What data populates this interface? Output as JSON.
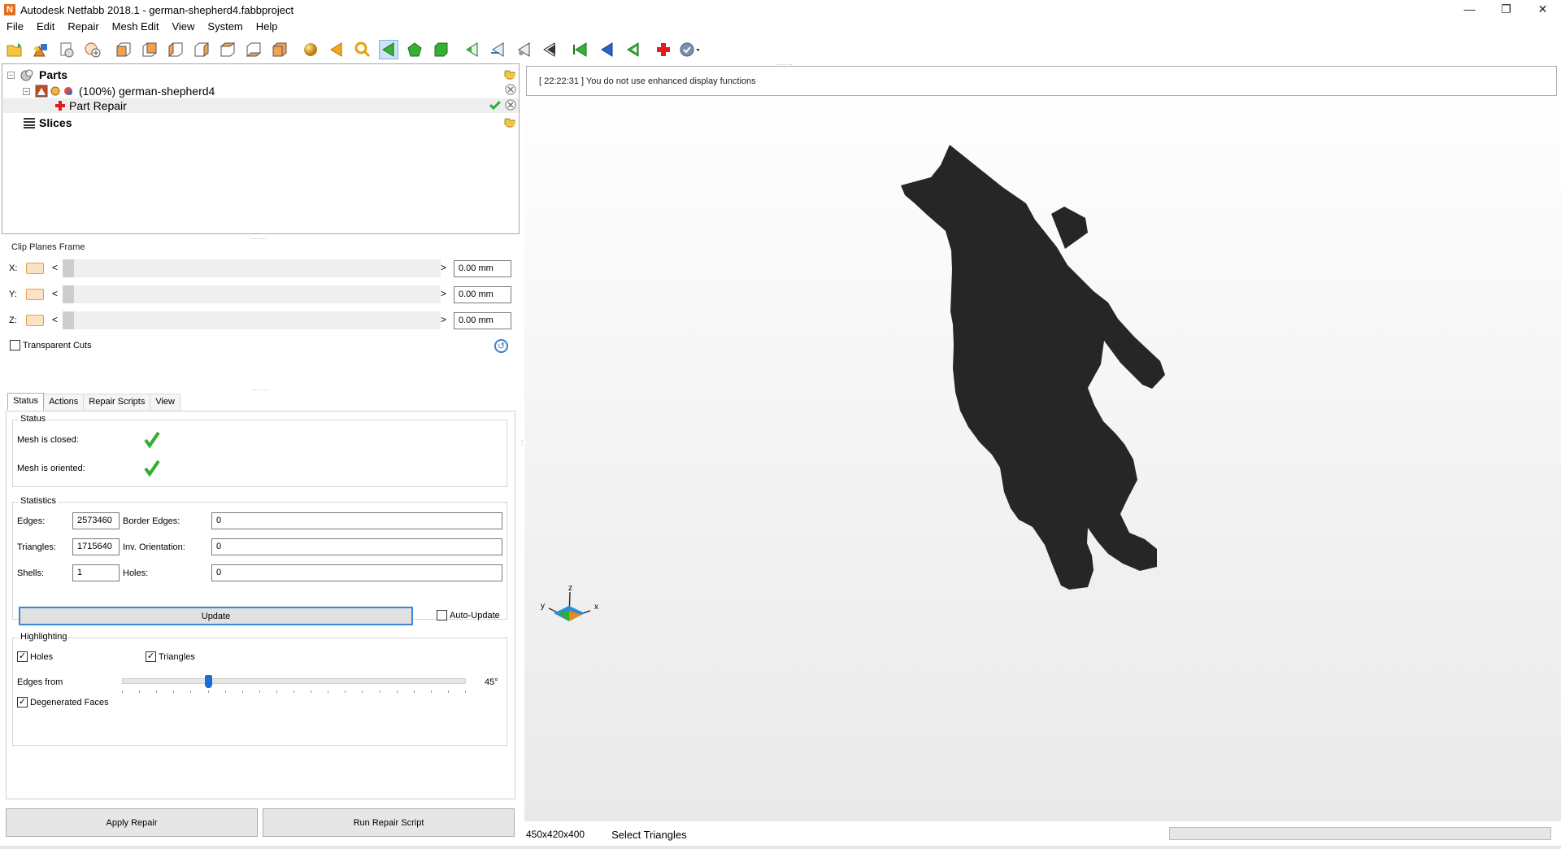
{
  "window": {
    "title": "Autodesk Netfabb 2018.1 - german-shepherd4.fabbproject",
    "app_icon_letter": "N",
    "controls": {
      "minimize": "—",
      "restore": "❐",
      "close": "✕"
    }
  },
  "menu": [
    "File",
    "Edit",
    "Repair",
    "Mesh Edit",
    "View",
    "System",
    "Help"
  ],
  "toolbar": {
    "icons": [
      "open-project-icon",
      "add-part-icon",
      "project-settings-icon",
      "new-part-icon",
      "view-front-icon",
      "view-back-icon",
      "view-left-icon",
      "view-right-icon",
      "view-top-icon",
      "view-bottom-icon",
      "view-iso-icon",
      "sphere-icon",
      "arrow-left-icon",
      "zoom-icon",
      "select-triangle-icon",
      "select-surface-icon",
      "select-shell-icon",
      "add-triangle-icon",
      "split-icon",
      "remove-icon",
      "cut-icon",
      "select-all-icon",
      "invert-selection-icon",
      "deselect-icon",
      "repair-icon",
      "help-icon"
    ]
  },
  "tree": {
    "parts_label": "Parts",
    "part_name": "(100%) german-shepherd4",
    "repair_label": "Part Repair",
    "slices_label": "Slices"
  },
  "clip": {
    "title": "Clip Planes Frame",
    "rows": [
      {
        "axis": "X:",
        "value": "0.00 mm"
      },
      {
        "axis": "Y:",
        "value": "0.00 mm"
      },
      {
        "axis": "Z:",
        "value": "0.00 mm"
      }
    ],
    "left_arrow": "<",
    "right_arrow": ">",
    "transparent_label": "Transparent Cuts"
  },
  "tabs": [
    "Status",
    "Actions",
    "Repair Scripts",
    "View"
  ],
  "status": {
    "group_title": "Status",
    "mesh_closed": "Mesh is closed:",
    "mesh_oriented": "Mesh is oriented:"
  },
  "statistics": {
    "group_title": "Statistics",
    "edges_label": "Edges:",
    "edges": "2573460",
    "border_edges_label": "Border Edges:",
    "border_edges": "0",
    "triangles_label": "Triangles:",
    "triangles": "1715640",
    "inv_orientation_label": "Inv. Orientation:",
    "inv_orientation": "0",
    "shells_label": "Shells:",
    "shells": "1",
    "holes_label": "Holes:",
    "holes": "0",
    "update_label": "Update",
    "auto_update_label": "Auto-Update"
  },
  "highlighting": {
    "group_title": "Highlighting",
    "holes_label": "Holes",
    "triangles_label": "Triangles",
    "edges_from_label": "Edges from",
    "edges_from_value": "45°",
    "edges_from_fraction": 0.25,
    "degenerated_label": "Degenerated Faces"
  },
  "buttons": {
    "apply_repair": "Apply Repair",
    "run_script": "Run Repair Script"
  },
  "viewport": {
    "log": "[ 22:22:31 ] You do not use enhanced display functions",
    "axis_x": "x",
    "axis_y": "y",
    "axis_z": "z"
  },
  "statusbar": {
    "dimensions": "450x420x400",
    "message": "Select Triangles"
  },
  "colors": {
    "accent": "#3a86d9",
    "model": "#262626",
    "green_check": "#2fae2f",
    "orange": "#e88a1a"
  }
}
